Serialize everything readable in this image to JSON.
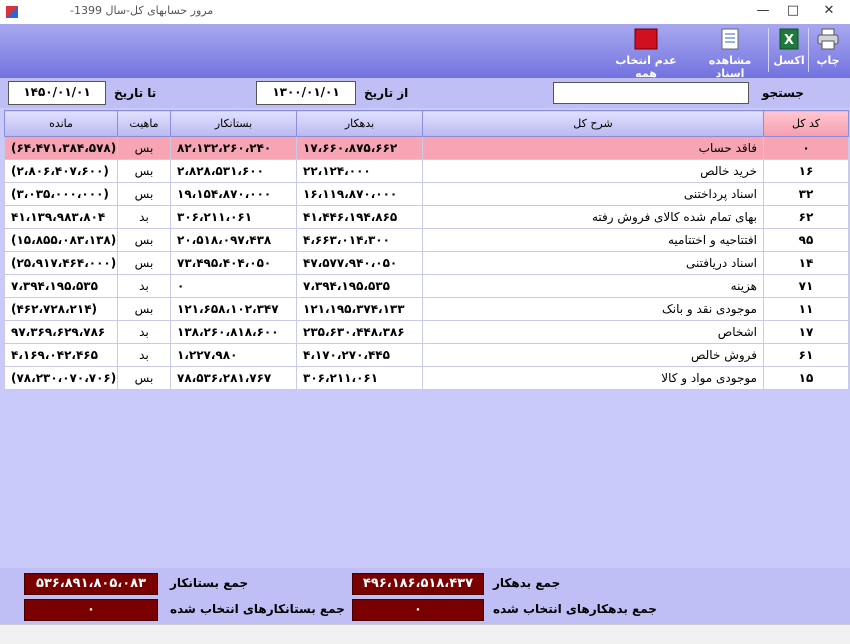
{
  "window": {
    "title": "مرور حسابهای کل-سال 1399-"
  },
  "toolbar": {
    "print_label": "چاپ",
    "excel_label": "اکسل",
    "view_docs_label": "مشاهده اسناد",
    "deselect_all_label": "عدم انتخاب همه"
  },
  "filter": {
    "search_label": "جستجو",
    "search_value": "",
    "from_label": "از تاریخ",
    "from_value": "۱۳۰۰/۰۱/۰۱",
    "to_label": "تا تاریخ",
    "to_value": "۱۴۵۰/۰۱/۰۱"
  },
  "grid": {
    "headers": {
      "code": "کد کل",
      "desc": "شرح کل",
      "debit": "بدهکار",
      "credit": "بستانکار",
      "nature": "ماهیت",
      "balance": "مانده"
    },
    "rows": [
      {
        "code": "۰",
        "desc": "فاقد حساب",
        "debit": "۱۷،۶۶۰،۸۷۵،۶۶۲",
        "credit": "۸۲،۱۳۲،۲۶۰،۲۴۰",
        "nature": "بس",
        "balance": "(۶۴،۴۷۱،۳۸۴،۵۷۸)"
      },
      {
        "code": "۱۶",
        "desc": "خرید خالص",
        "debit": "۲۲،۱۲۴،۰۰۰",
        "credit": "۲،۸۲۸،۵۳۱،۶۰۰",
        "nature": "بس",
        "balance": "(۲،۸۰۶،۴۰۷،۶۰۰)"
      },
      {
        "code": "۳۲",
        "desc": "اسناد پرداختنی",
        "debit": "۱۶،۱۱۹،۸۷۰،۰۰۰",
        "credit": "۱۹،۱۵۴،۸۷۰،۰۰۰",
        "nature": "بس",
        "balance": "(۳،۰۳۵،۰۰۰،۰۰۰)"
      },
      {
        "code": "۶۲",
        "desc": "بهای تمام شده کالای فروش رفته",
        "debit": "۴۱،۴۴۶،۱۹۴،۸۶۵",
        "credit": "۳۰۶،۲۱۱،۰۶۱",
        "nature": "بد",
        "balance": "۴۱،۱۳۹،۹۸۳،۸۰۴"
      },
      {
        "code": "۹۵",
        "desc": "افتتاحیه و اختتامیه",
        "debit": "۴،۶۶۳،۰۱۴،۳۰۰",
        "credit": "۲۰،۵۱۸،۰۹۷،۴۳۸",
        "nature": "بس",
        "balance": "(۱۵،۸۵۵،۰۸۳،۱۳۸)"
      },
      {
        "code": "۱۴",
        "desc": "اسناد دریافتنی",
        "debit": "۴۷،۵۷۷،۹۴۰،۰۵۰",
        "credit": "۷۳،۴۹۵،۴۰۴،۰۵۰",
        "nature": "بس",
        "balance": "(۲۵،۹۱۷،۴۶۴،۰۰۰)"
      },
      {
        "code": "۷۱",
        "desc": "هزینه",
        "debit": "۷،۳۹۴،۱۹۵،۵۳۵",
        "credit": "۰",
        "nature": "بد",
        "balance": "۷،۳۹۴،۱۹۵،۵۳۵"
      },
      {
        "code": "۱۱",
        "desc": "موجودی نقد و بانک",
        "debit": "۱۲۱،۱۹۵،۳۷۴،۱۳۳",
        "credit": "۱۲۱،۶۵۸،۱۰۲،۳۴۷",
        "nature": "بس",
        "balance": "(۴۶۲،۷۲۸،۲۱۴)"
      },
      {
        "code": "۱۷",
        "desc": "اشخاص",
        "debit": "۲۳۵،۶۳۰،۴۴۸،۳۸۶",
        "credit": "۱۳۸،۲۶۰،۸۱۸،۶۰۰",
        "nature": "بد",
        "balance": "۹۷،۳۶۹،۶۲۹،۷۸۶"
      },
      {
        "code": "۶۱",
        "desc": "فروش خالص",
        "debit": "۴،۱۷۰،۲۷۰،۴۴۵",
        "credit": "۱،۲۲۷،۹۸۰",
        "nature": "بد",
        "balance": "۴،۱۶۹،۰۴۲،۴۶۵"
      },
      {
        "code": "۱۵",
        "desc": "موجودی مواد و کالا",
        "debit": "۳۰۶،۲۱۱،۰۶۱",
        "credit": "۷۸،۵۳۶،۲۸۱،۷۶۷",
        "nature": "بس",
        "balance": "(۷۸،۲۳۰،۰۷۰،۷۰۶)"
      }
    ]
  },
  "totals": {
    "debit_label": "جمع بدهکار",
    "debit_value": "۴۹۶،۱۸۶،۵۱۸،۴۳۷",
    "credit_label": "جمع بستانکار",
    "credit_value": "۵۳۶،۸۹۱،۸۰۵،۰۸۳",
    "sel_debit_label": "جمع بدهکارهای انتخاب شده",
    "sel_debit_value": "۰",
    "sel_credit_label": "جمع بستانکارهای انتخاب شده",
    "sel_credit_value": "۰"
  }
}
